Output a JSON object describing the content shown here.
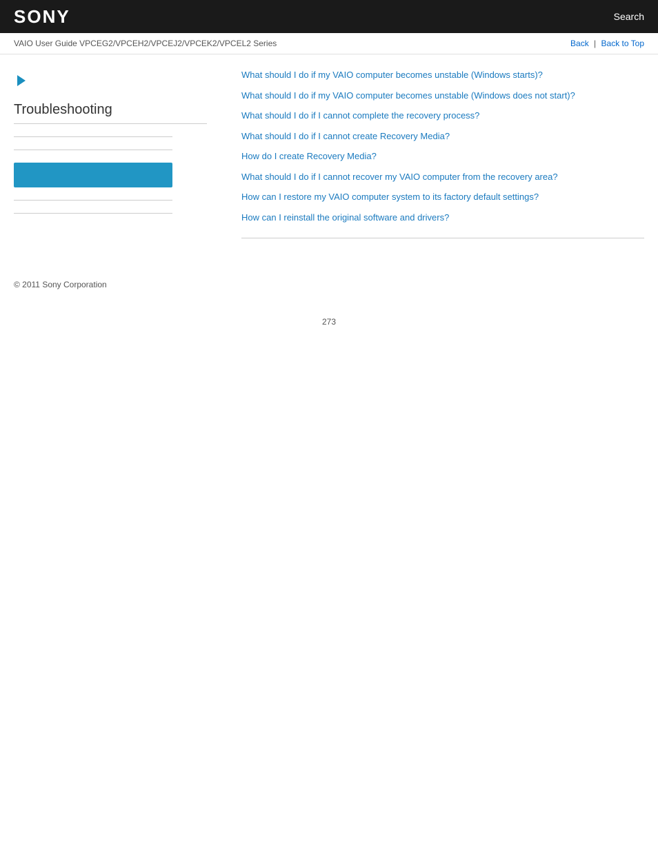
{
  "header": {
    "logo": "SONY",
    "search_label": "Search"
  },
  "breadcrumb": {
    "text": "VAIO User Guide VPCEG2/VPCEH2/VPCEJ2/VPCEK2/VPCEL2 Series",
    "back_label": "Back",
    "back_to_top_label": "Back to Top",
    "separator": "|"
  },
  "sidebar": {
    "section_title": "Troubleshooting"
  },
  "content": {
    "links": [
      {
        "id": 1,
        "text": "What should I do if my VAIO computer becomes unstable (Windows starts)?"
      },
      {
        "id": 2,
        "text": "What should I do if my VAIO computer becomes unstable (Windows does not start)?"
      },
      {
        "id": 3,
        "text": "What should I do if I cannot complete the recovery process?"
      },
      {
        "id": 4,
        "text": "What should I do if I cannot create Recovery Media?"
      },
      {
        "id": 5,
        "text": "How do I create Recovery Media?"
      },
      {
        "id": 6,
        "text": "What should I do if I cannot recover my VAIO computer from the recovery area?"
      },
      {
        "id": 7,
        "text": "How can I restore my VAIO computer system to its factory default settings?"
      },
      {
        "id": 8,
        "text": "How can I reinstall the original software and drivers?"
      }
    ]
  },
  "footer": {
    "copyright": "© 2011 Sony Corporation"
  },
  "page_number": "273",
  "colors": {
    "header_bg": "#1a1a1a",
    "link_color": "#1a7abf",
    "highlight_box": "#2196c4",
    "divider": "#ccc"
  }
}
